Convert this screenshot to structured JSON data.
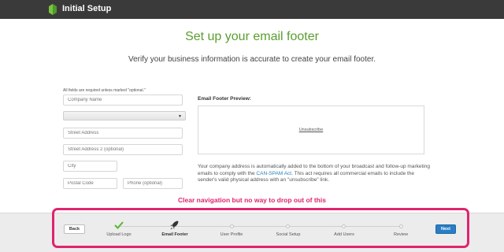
{
  "header": {
    "app_title": "Initial Setup",
    "logo_icon": "initial-setup-logo-icon"
  },
  "main": {
    "title": "Set up your email footer",
    "subtitle": "Verify your business information is accurate to create your email footer.",
    "required_note": "All fields are required unless marked \"optional.\""
  },
  "form": {
    "company_name": {
      "placeholder": "Company Name",
      "value": ""
    },
    "country": {
      "value": ""
    },
    "street_address": {
      "placeholder": "Street Address",
      "value": ""
    },
    "street_address_2": {
      "placeholder": "Street Address 2 (optional)",
      "value": ""
    },
    "city": {
      "placeholder": "City",
      "value": ""
    },
    "postal_code": {
      "placeholder": "Postal Code",
      "value": ""
    },
    "phone": {
      "placeholder": "Phone (optional)",
      "value": ""
    }
  },
  "preview": {
    "label": "Email Footer Preview:",
    "unsubscribe": "Unsubscribe"
  },
  "info": {
    "text_before": "Your company address is automatically added to the bottom of your broadcast and follow-up marketing emails to comply with the ",
    "link": "CAN-SPAM Act",
    "text_after": ". This act requires all commercial emails to include the sender's valid physical address with an \"unsubscribe\" link."
  },
  "annotation": "Clear navigation but no way to drop out of this",
  "footer": {
    "back_label": "Back",
    "next_label": "Next",
    "steps": [
      {
        "label": "Upload Logo",
        "state": "completed",
        "icon": "checkmark-icon"
      },
      {
        "label": "Email Footer",
        "state": "current",
        "icon": "rocket-icon"
      },
      {
        "label": "User Profile",
        "state": "upcoming"
      },
      {
        "label": "Social Setup",
        "state": "upcoming"
      },
      {
        "label": "Add Users",
        "state": "upcoming"
      },
      {
        "label": "Review",
        "state": "upcoming"
      }
    ]
  },
  "colors": {
    "accent_green": "#5a9e2f",
    "annotation_pink": "#e0246e",
    "next_blue": "#2a7dc4",
    "topbar": "#3a3a3a"
  }
}
